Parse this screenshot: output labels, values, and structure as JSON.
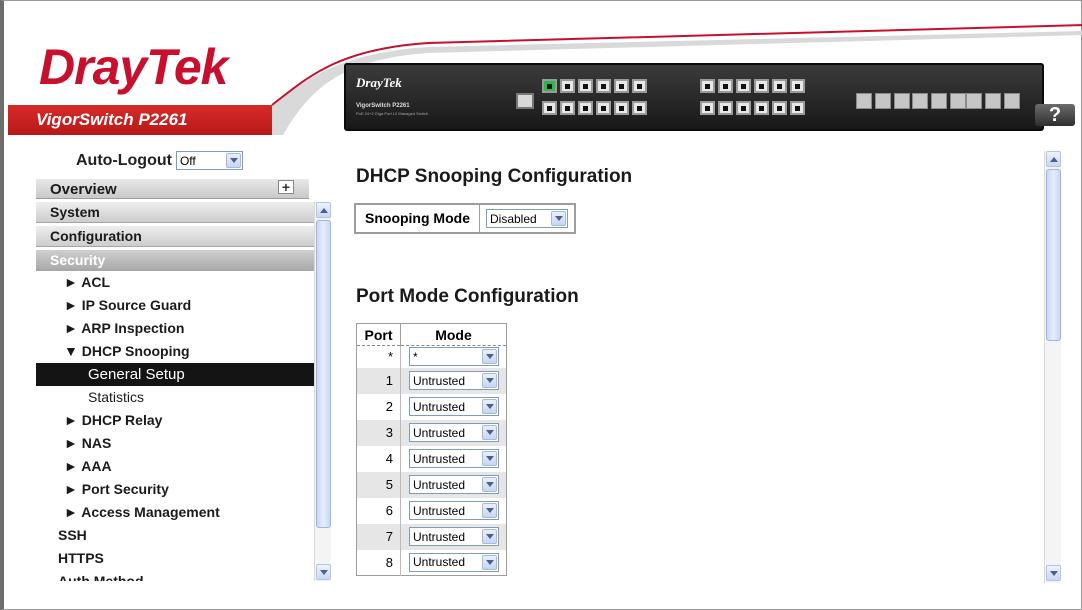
{
  "header": {
    "logo": "DrayTek",
    "product": "VigorSwitch P2261",
    "panel_brand": "DrayTek",
    "panel_model": "VigorSwitch P2261",
    "panel_subtitle": "PoE 24+2 Giga Port L2 Managed Switch",
    "help_label": "?"
  },
  "autologout": {
    "label": "Auto-Logout",
    "value": "Off"
  },
  "sidebar": {
    "overview": "Overview",
    "system": "System",
    "configuration": "Configuration",
    "security": "Security",
    "items": [
      {
        "label": "► ACL"
      },
      {
        "label": "► IP Source Guard"
      },
      {
        "label": "► ARP Inspection"
      },
      {
        "label": "▼ DHCP Snooping"
      }
    ],
    "sub_items": [
      {
        "label": "General Setup"
      },
      {
        "label": "Statistics"
      }
    ],
    "more_items": [
      {
        "label": "► DHCP Relay"
      },
      {
        "label": "► NAS"
      },
      {
        "label": "► AAA"
      },
      {
        "label": "► Port Security"
      },
      {
        "label": "► Access Management"
      }
    ],
    "top_items": [
      {
        "label": "SSH"
      },
      {
        "label": "HTTPS"
      },
      {
        "label": "Auth Method"
      }
    ]
  },
  "main": {
    "title": "DHCP Snooping Configuration",
    "snooping_label": "Snooping Mode",
    "snooping_value": "Disabled",
    "port_title": "Port Mode Configuration",
    "table": {
      "headers": [
        "Port",
        "Mode"
      ],
      "rows": [
        {
          "port": "*",
          "mode": "*"
        },
        {
          "port": "1",
          "mode": "Untrusted"
        },
        {
          "port": "2",
          "mode": "Untrusted"
        },
        {
          "port": "3",
          "mode": "Untrusted"
        },
        {
          "port": "4",
          "mode": "Untrusted"
        },
        {
          "port": "5",
          "mode": "Untrusted"
        },
        {
          "port": "6",
          "mode": "Untrusted"
        },
        {
          "port": "7",
          "mode": "Untrusted"
        },
        {
          "port": "8",
          "mode": "Untrusted"
        }
      ]
    }
  },
  "colors": {
    "brand_red": "#c8102e",
    "selected_nav": "#141414"
  }
}
